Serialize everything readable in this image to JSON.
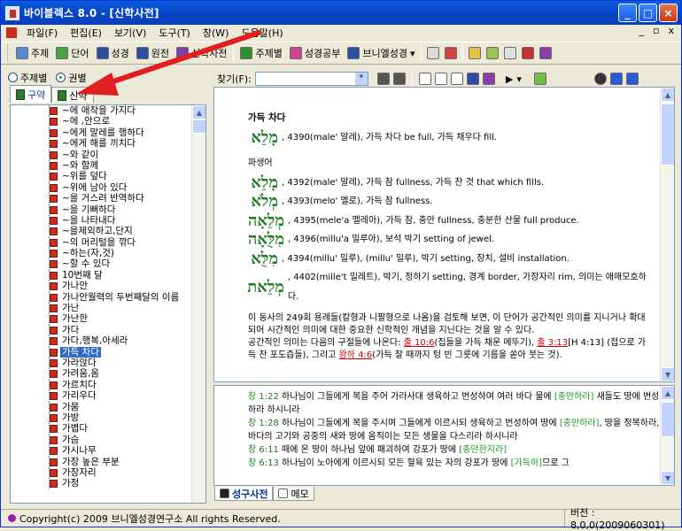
{
  "window": {
    "title": "바이블렉스 8.0 - [신학사전]"
  },
  "menu": [
    "파일(F)",
    "편집(E)",
    "보기(V)",
    "도구(T)",
    "창(W)",
    "도움말(H)"
  ],
  "mdi_buttons": [
    "_",
    "▫",
    "x"
  ],
  "toolbar": [
    "주제",
    "단어",
    "성경",
    "원전",
    "신학사전",
    "주제별",
    "성경공부",
    "브니엘성경"
  ],
  "radios": {
    "topic": "주제별",
    "book": "권별"
  },
  "tabs": {
    "ot": "구약",
    "nt": "신약"
  },
  "find": {
    "label": "찾기(F):",
    "value": ""
  },
  "tree_items": [
    "~에 애착을 가지다",
    "~에 ,안으로",
    "~에게 말레를 행하다",
    "~에게 해를 끼치다",
    "~와 같이",
    "~와 함께",
    "~위를 덮다",
    "~위에 남아 있다",
    "~을 거스려 반역하다",
    "~을 기뻐하다",
    "~을 나타내다",
    "~을제외하고,단지",
    "~의 머리털을 깎다",
    "~하는(자,것)",
    "~할 수 있다",
    "10번째 달",
    "가나안",
    "가나안월력의 두번째달의 이름",
    "가난",
    "가난한",
    "가다",
    "가다,행복,아세라",
    "가득 차다",
    "가라앉다",
    "가려움,옴",
    "가르치다",
    "가리우다",
    "가뭄",
    "가방",
    "가볍다",
    "가슴",
    "가시나무",
    "가장 높은 부분",
    "가장자리",
    "가정"
  ],
  "tree_selected": "가득 차다",
  "entry": {
    "headword": "가득 차다",
    "main": {
      "heb": "מָלֵא",
      "text": ", 4390(male' 말레), 가득 차다 be full, 가득 채우다 fill."
    },
    "derived_label": "파생어",
    "derived": [
      {
        "heb": "מָלֵא",
        "text": ", 4392(male' 말레), 가득 참 fullness, 가득 찬 것 that which fills."
      },
      {
        "heb": "מְלֹא",
        "text": ", 4393(melo' 멜로), 가득 참 fullness."
      },
      {
        "heb": "מְלֵאָה",
        "text": ", 4395(mele'a 멜레아), 가득 참, 충만 fullness, 충분한 산물 full produce."
      },
      {
        "heb": "מִלֻּאָה",
        "text": ", 4396(millu'a 밀루아), 보석 박기 setting of jewel."
      },
      {
        "heb": "מִלֻּא",
        "text": ", 4394(millu' 밀루), (millu' 밀루), 박기 setting, 장치, 설비 installation."
      },
      {
        "heb": "מְלֵאת",
        "text": ", 4402(mille't 밀레트), 박기, 정하기 setting, 경계 border, 가장자리 rim, 의미는 애매모호하다."
      }
    ],
    "para1": "이 동사의 249회 용례들(칼형과 니팔형으로 나옴)을 검토해 보면, 이 단어가 공간적인 의미를 지니거나 확대되어 시간적인 의미에 대한 중요한 신학적인 개념을 지닌다는 것을 알 수 있다.",
    "para2_a": "공간적인 의미는 다음의 구절들에 나온다: ",
    "link1": "출 10:6",
    "para2_b": "(집들을 가득 채운 메뚜기), ",
    "link2": "출 3:13",
    "para2_c": "[H 4:13] (접으로 가득 찬 포도즙들), 그리고 ",
    "link3": "왕하 4:6",
    "para2_d": "(가득 찰 때까지 텅 빈 그릇에 기름을 쏟아 붓는 것)."
  },
  "verses": [
    {
      "ref": "창 1:22",
      "pre": " 하나님이 그들에게 복을 주어 가라사대 생육하고 번성하여 여러 바다 물에 ",
      "kw": "[충만하라]",
      "post": " 새들도 땅에 번성하라 하시니라"
    },
    {
      "ref": "창 1:28",
      "pre": " 하나님이 그들에게 복을 주시며 그들에게 이르시되 생육하고 번성하여 땅에 ",
      "kw": "[충만하라]",
      "post": ", 땅을 정복하라, 바다의 고기와 공중의 새와 땅에 움직이는 모든 생물을 다스리라 하시니라"
    },
    {
      "ref": "창 6:11",
      "pre": " 때에 온 땅이 하나님 앞에 패괴하여 강포가 땅에 ",
      "kw": "[충만한지라]",
      "post": ""
    },
    {
      "ref": "창 6:13",
      "pre": " 하나님이 노아에게 이르시되 모든 혈육 있는 자의 강포가 땅에 ",
      "kw": "[가득하]",
      "post": "므로 그"
    }
  ],
  "bottom_tabs": {
    "dict": "성구사전",
    "memo": "메모"
  },
  "status": {
    "copyright": "Copyright(c) 2009 브니엘성경연구소 All rights Reserved.",
    "version": "버전 : 8,0,0(2009060301)"
  },
  "colors": {
    "accent": "#0054e3",
    "hebrew": "#1f7a1f",
    "link": "#d40000",
    "arrow": "#e02020"
  }
}
